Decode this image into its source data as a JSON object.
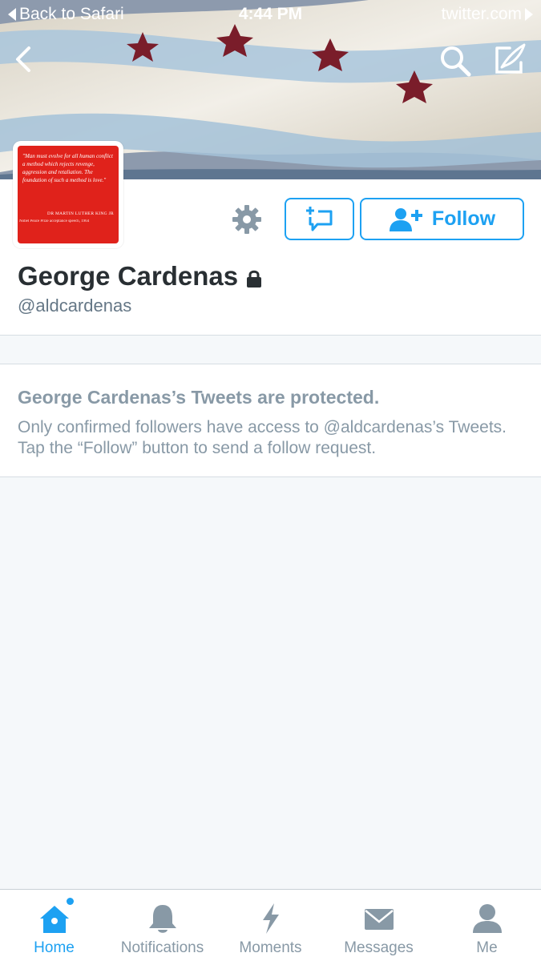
{
  "statusbar": {
    "back_label": "Back to Safari",
    "time": "4:44 PM",
    "site": "twitter.com"
  },
  "profile": {
    "display_name": "George Cardenas",
    "handle": "@aldcardenas",
    "follow_label": "Follow",
    "avatar": {
      "quote": "\"Man must evolve for all human conflict a method which rejects revenge, aggression and retaliation. The foundation of such a method is love.\"",
      "author": "DR MARTIN LUTHER KING JR",
      "subtitle": "Nobel Peace Prize acceptance speech, 1964"
    }
  },
  "protected_notice": {
    "title": "George Cardenas’s Tweets are protected.",
    "body": "Only confirmed followers have access to @aldcardenas’s Tweets. Tap the “Follow” button to send a follow request."
  },
  "tabbar": {
    "tabs": [
      {
        "label": "Home",
        "icon": "home-icon",
        "active": true
      },
      {
        "label": "Notifications",
        "icon": "bell-icon",
        "active": false
      },
      {
        "label": "Moments",
        "icon": "lightning-icon",
        "active": false
      },
      {
        "label": "Messages",
        "icon": "envelope-icon",
        "active": false
      },
      {
        "label": "Me",
        "icon": "person-icon",
        "active": false
      }
    ]
  },
  "colors": {
    "accent": "#1da1f2",
    "muted": "#8899a6",
    "background": "#f5f8fa",
    "avatar_red": "#e0221b"
  }
}
